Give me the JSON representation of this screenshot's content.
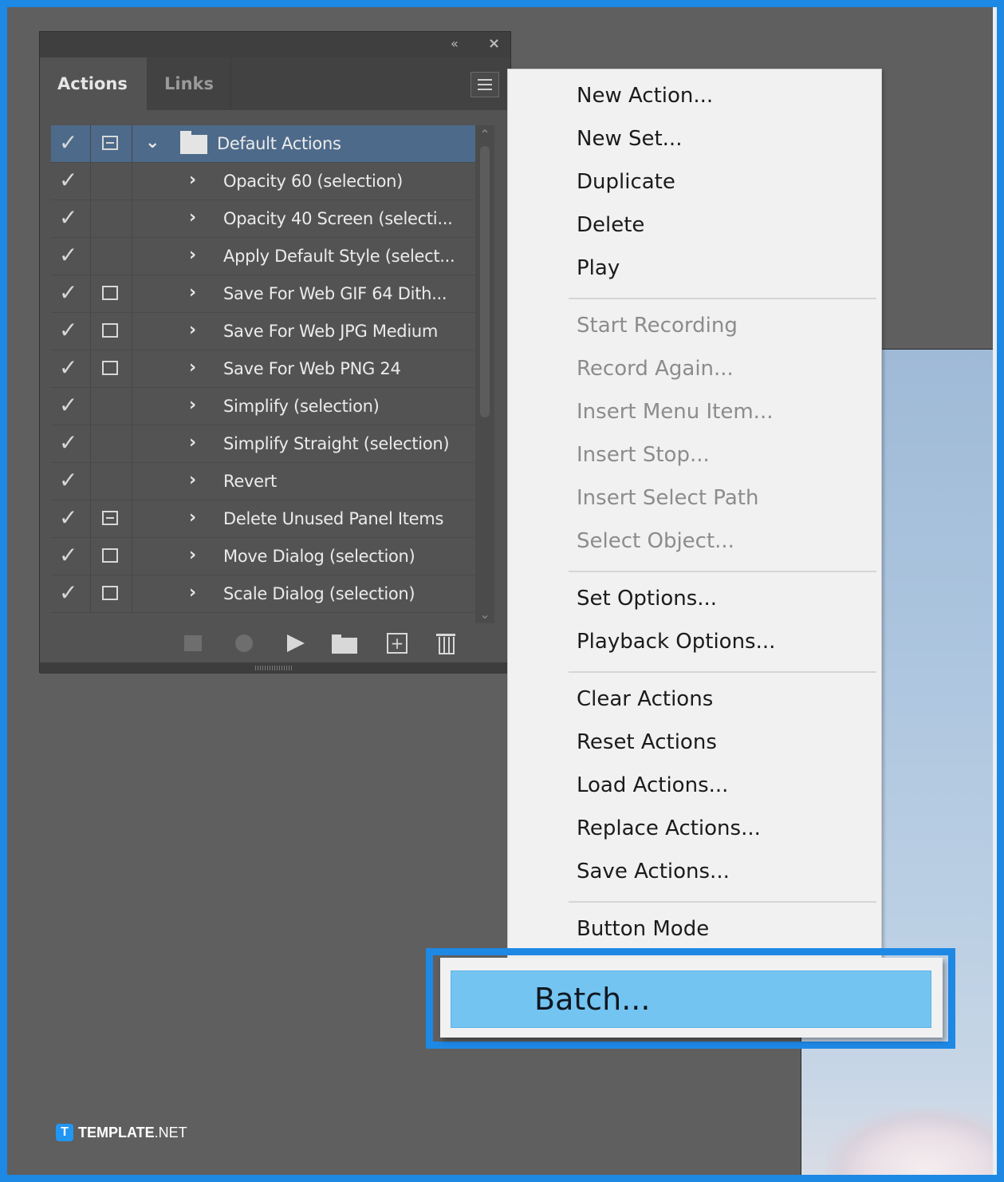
{
  "panel": {
    "tabs": [
      "Actions",
      "Links"
    ],
    "collapse_icon": "«",
    "close_icon": "×",
    "set": {
      "label": "Default Actions"
    },
    "actions": [
      {
        "label": "Opacity 60 (selection)",
        "dialog": "none"
      },
      {
        "label": "Opacity 40 Screen (selecti...",
        "dialog": "none"
      },
      {
        "label": "Apply Default Style (select...",
        "dialog": "none"
      },
      {
        "label": "Save For Web GIF 64 Dith...",
        "dialog": "on"
      },
      {
        "label": "Save For Web JPG Medium",
        "dialog": "on"
      },
      {
        "label": "Save For Web PNG 24",
        "dialog": "on"
      },
      {
        "label": "Simplify (selection)",
        "dialog": "none"
      },
      {
        "label": "Simplify Straight (selection)",
        "dialog": "none"
      },
      {
        "label": "Revert",
        "dialog": "none"
      },
      {
        "label": "Delete Unused Panel Items",
        "dialog": "partial"
      },
      {
        "label": "Move Dialog (selection)",
        "dialog": "on"
      },
      {
        "label": "Scale Dialog (selection)",
        "dialog": "on"
      }
    ],
    "toolbar_icons": [
      "stop-icon",
      "record-icon",
      "play-icon",
      "new-set-icon",
      "new-action-icon",
      "trash-icon"
    ]
  },
  "menu": {
    "groups": [
      [
        {
          "label": "New Action...",
          "enabled": true
        },
        {
          "label": "New Set...",
          "enabled": true
        },
        {
          "label": "Duplicate",
          "enabled": true
        },
        {
          "label": "Delete",
          "enabled": true
        },
        {
          "label": "Play",
          "enabled": true
        }
      ],
      [
        {
          "label": "Start Recording",
          "enabled": false
        },
        {
          "label": "Record Again...",
          "enabled": false
        },
        {
          "label": "Insert Menu Item...",
          "enabled": false
        },
        {
          "label": "Insert Stop...",
          "enabled": false
        },
        {
          "label": "Insert Select Path",
          "enabled": false
        },
        {
          "label": "Select Object...",
          "enabled": false
        }
      ],
      [
        {
          "label": "Set Options...",
          "enabled": true
        },
        {
          "label": "Playback Options...",
          "enabled": true
        }
      ],
      [
        {
          "label": "Clear Actions",
          "enabled": true
        },
        {
          "label": "Reset Actions",
          "enabled": true
        },
        {
          "label": "Load Actions...",
          "enabled": true
        },
        {
          "label": "Replace Actions...",
          "enabled": true
        },
        {
          "label": "Save Actions...",
          "enabled": true
        }
      ],
      [
        {
          "label": "Button Mode",
          "enabled": true
        }
      ]
    ],
    "highlighted": {
      "label": "Batch..."
    }
  },
  "watermark": {
    "logo": "T",
    "brand": "TEMPLATE",
    "suffix": ".NET"
  },
  "colors": {
    "border_accent": "#1e88e5",
    "highlight": "#74c4f2",
    "panel_bg": "#535353",
    "selected_row": "#4d6a8a"
  }
}
